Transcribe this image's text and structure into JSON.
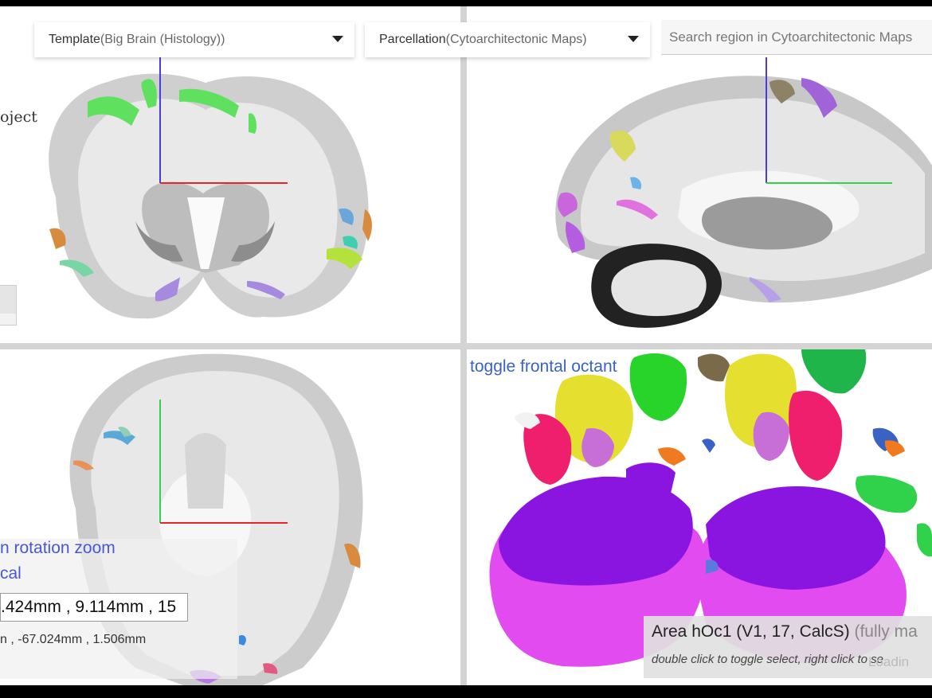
{
  "template_select": {
    "label": "Template",
    "value": "(Big Brain (Histology))"
  },
  "parcellation_select": {
    "label": "Parcellation",
    "value": "(Cytoarchitectonic Maps)"
  },
  "search": {
    "placeholder": "Search region in Cytoarchitectonic Maps"
  },
  "left_clipped_text": "oject",
  "views": {
    "coronal": {
      "name": "coronal-view"
    },
    "sagittal": {
      "name": "sagittal-view"
    },
    "axial": {
      "name": "axial-view"
    },
    "perspective": {
      "name": "3d-view"
    }
  },
  "perspective": {
    "toggle_label": "toggle frontal octant"
  },
  "navigation": {
    "mode_label": "n rotation zoom",
    "physical_label": "cal",
    "coord_value": ".424mm , 9.114mm , 15",
    "voxel_coord": "n , -67.024mm , 1.506mm"
  },
  "region_info": {
    "name": "Area hOc1 (V1, 17, CalcS)",
    "status": "(fully ma",
    "hint": "double click to toggle select, right click to se",
    "loading": "Loadin"
  },
  "colors": {
    "axis_red": "#e8242a",
    "axis_green": "#2fd24a",
    "axis_blue": "#4a3be0",
    "link_blue": "#3a62c4"
  }
}
